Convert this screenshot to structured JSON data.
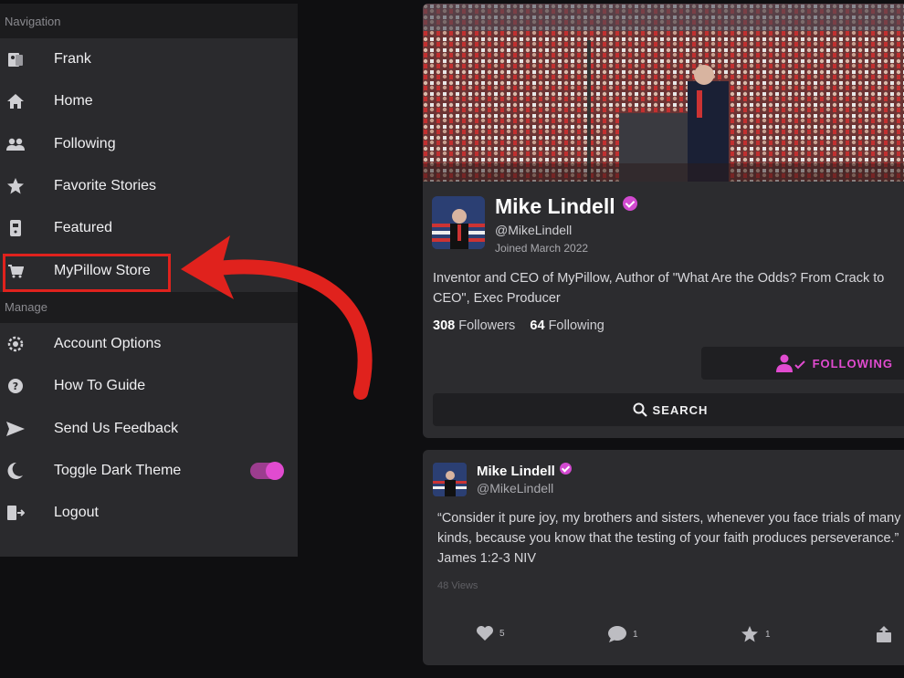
{
  "sidebar": {
    "navigation_header": "Navigation",
    "items": [
      {
        "label": "Frank",
        "icon": "profile-icon"
      },
      {
        "label": "Home",
        "icon": "home-icon"
      },
      {
        "label": "Following",
        "icon": "users-icon"
      },
      {
        "label": "Favorite Stories",
        "icon": "star-icon"
      },
      {
        "label": "Featured",
        "icon": "featured-icon"
      },
      {
        "label": "MyPillow Store",
        "icon": "cart-icon"
      }
    ],
    "manage_header": "Manage",
    "manage_items": [
      {
        "label": "Account Options",
        "icon": "gear-icon"
      },
      {
        "label": "How To Guide",
        "icon": "help-icon"
      },
      {
        "label": "Send Us Feedback",
        "icon": "send-icon"
      },
      {
        "label": "Toggle Dark Theme",
        "icon": "moon-icon"
      },
      {
        "label": "Logout",
        "icon": "logout-icon"
      }
    ],
    "dark_theme_on": true
  },
  "profile": {
    "name": "Mike Lindell",
    "handle": "@MikeLindell",
    "joined": "Joined March 2022",
    "bio": "Inventor and CEO of MyPillow, Author of \"What Are the Odds? From Crack to CEO\", Exec Producer",
    "followers_count": "308",
    "followers_label": "Followers",
    "following_count": "64",
    "following_label": "Following",
    "follow_button": "FOLLOWING",
    "search_button": "SEARCH"
  },
  "post": {
    "name": "Mike Lindell",
    "handle": "@MikeLindell",
    "text": "“Consider it pure joy, my brothers and sisters, whenever you face trials of many kinds, because you know that the testing of your faith produces perseverance.” James 1:2-3 NIV",
    "views": "48 Views",
    "likes": "5",
    "comments": "1",
    "favorites": "1"
  },
  "colors": {
    "accent": "#e14bd0",
    "highlight_box": "#e0221d",
    "sidebar_bg": "#2a2a2d",
    "card_bg": "#2c2c2f"
  }
}
